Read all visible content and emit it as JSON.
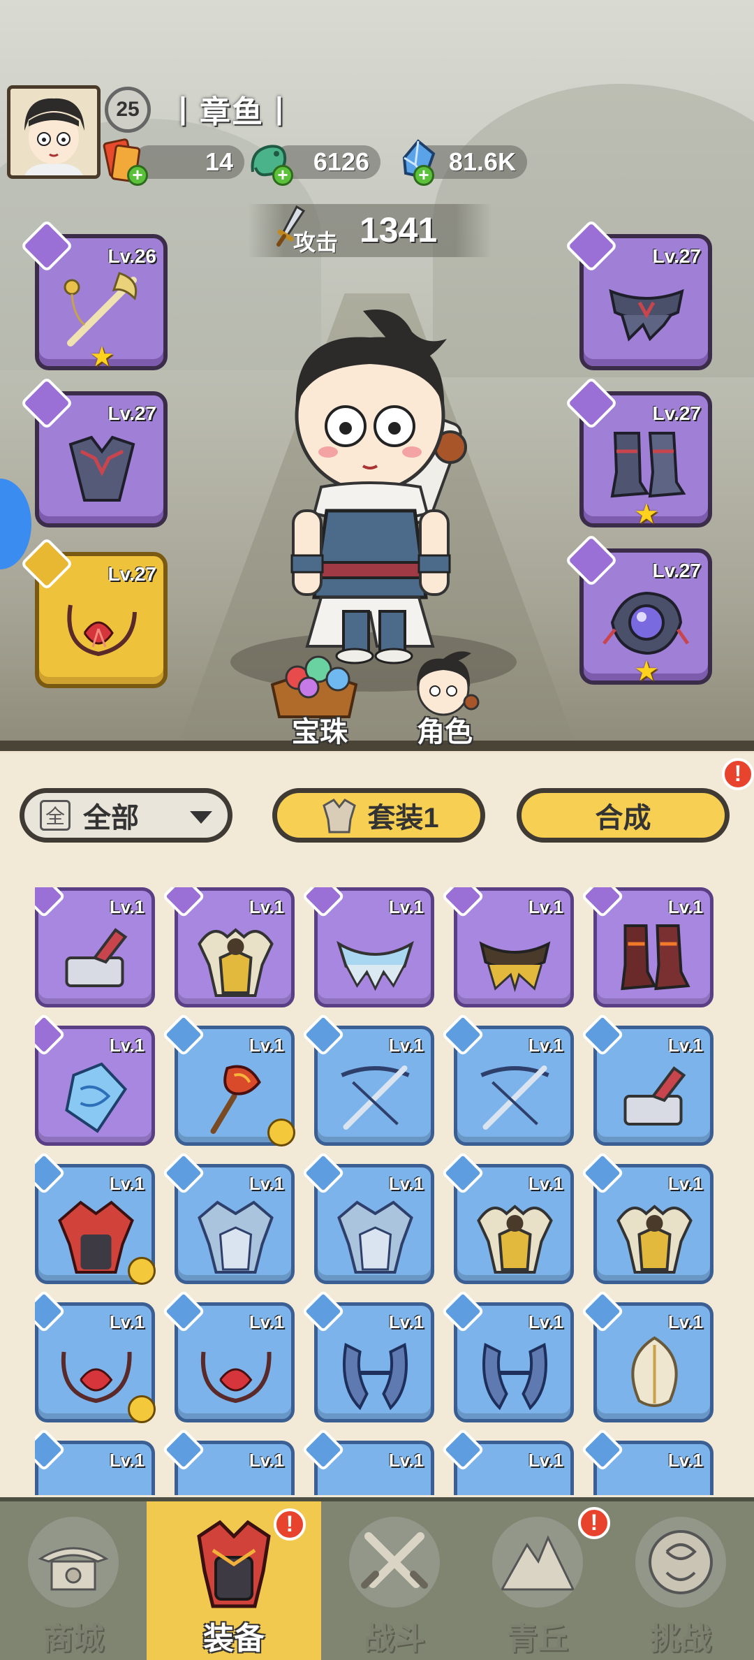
{
  "player": {
    "level": "25",
    "name": "丨章鱼丨"
  },
  "resources": [
    {
      "icon": "ticket-icon",
      "value": "14"
    },
    {
      "icon": "jade-dragon-icon",
      "value": "6126"
    },
    {
      "icon": "crystal-gem-icon",
      "value": "81.6K"
    }
  ],
  "attack": {
    "label": "攻击",
    "value": "1341"
  },
  "equipped": {
    "left": [
      {
        "slot": "weapon",
        "level": "Lv.26",
        "starred": true,
        "rarity": "purple"
      },
      {
        "slot": "armor",
        "level": "Lv.27",
        "starred": false,
        "rarity": "purple"
      },
      {
        "slot": "necklace",
        "level": "Lv.27",
        "starred": false,
        "rarity": "gold"
      }
    ],
    "right": [
      {
        "slot": "belt",
        "level": "Lv.27",
        "starred": false,
        "rarity": "purple"
      },
      {
        "slot": "boots",
        "level": "Lv.27",
        "starred": true,
        "rarity": "purple"
      },
      {
        "slot": "ring",
        "level": "Lv.27",
        "starred": true,
        "rarity": "purple"
      }
    ]
  },
  "scene_buttons": {
    "orbs": "宝珠",
    "role": "角色"
  },
  "toolbar": {
    "filter_icon_text": "全",
    "filter_label": "全部",
    "set_label": "套装1",
    "compose_label": "合成",
    "compose_alert": "!"
  },
  "inventory": [
    {
      "rarity": "purple",
      "type": "weapon",
      "level": "Lv.1",
      "art": "anvil-hammer-icon"
    },
    {
      "rarity": "purple",
      "type": "armor",
      "level": "Lv.1",
      "art": "gold-feather-armor-icon"
    },
    {
      "rarity": "purple",
      "type": "belt",
      "level": "Lv.1",
      "art": "ice-fur-belt-icon"
    },
    {
      "rarity": "purple",
      "type": "belt",
      "level": "Lv.1",
      "art": "gold-fur-belt-icon"
    },
    {
      "rarity": "purple",
      "type": "boots",
      "level": "Lv.1",
      "art": "fire-boots-icon"
    },
    {
      "rarity": "purple",
      "type": "ring",
      "level": "Lv.1",
      "art": "crystal-pendant-icon"
    },
    {
      "rarity": "blue",
      "type": "weapon",
      "level": "Lv.1",
      "art": "fire-slingshot-icon",
      "badge": true
    },
    {
      "rarity": "blue",
      "type": "weapon",
      "level": "Lv.1",
      "art": "crossbow-icon"
    },
    {
      "rarity": "blue",
      "type": "weapon",
      "level": "Lv.1",
      "art": "crossbow-icon"
    },
    {
      "rarity": "blue",
      "type": "weapon",
      "level": "Lv.1",
      "art": "anvil-hammer-icon"
    },
    {
      "rarity": "blue",
      "type": "armor",
      "level": "Lv.1",
      "art": "red-dragon-armor-icon",
      "badge": true
    },
    {
      "rarity": "blue",
      "type": "armor",
      "level": "Lv.1",
      "art": "ice-armor-icon"
    },
    {
      "rarity": "blue",
      "type": "armor",
      "level": "Lv.1",
      "art": "ice-armor-icon"
    },
    {
      "rarity": "blue",
      "type": "armor",
      "level": "Lv.1",
      "art": "gold-feather-armor-icon"
    },
    {
      "rarity": "blue",
      "type": "armor",
      "level": "Lv.1",
      "art": "gold-feather-armor-icon"
    },
    {
      "rarity": "blue",
      "type": "necklace",
      "level": "Lv.1",
      "art": "red-necklace-icon",
      "badge": true
    },
    {
      "rarity": "blue",
      "type": "necklace",
      "level": "Lv.1",
      "art": "red-necklace-icon"
    },
    {
      "rarity": "blue",
      "type": "necklace",
      "level": "Lv.1",
      "art": "ice-horn-icon"
    },
    {
      "rarity": "blue",
      "type": "necklace",
      "level": "Lv.1",
      "art": "ice-horn-icon"
    },
    {
      "rarity": "blue",
      "type": "necklace",
      "level": "Lv.1",
      "art": "feather-bundle-icon"
    },
    {
      "rarity": "blue",
      "type": "belt",
      "level": "Lv.1",
      "art": "belt-icon"
    },
    {
      "rarity": "blue",
      "type": "belt",
      "level": "Lv.1",
      "art": "belt-icon"
    },
    {
      "rarity": "blue",
      "type": "belt",
      "level": "Lv.1",
      "art": "belt-icon"
    },
    {
      "rarity": "blue",
      "type": "belt",
      "level": "Lv.1",
      "art": "belt-icon"
    },
    {
      "rarity": "blue",
      "type": "belt",
      "level": "Lv.1",
      "art": "belt-icon"
    }
  ],
  "nav": [
    {
      "label": "商城",
      "icon": "shop-pagoda-icon",
      "active": false,
      "alert": ""
    },
    {
      "label": "装备",
      "icon": "equipment-helmet-icon",
      "active": true,
      "alert": "!"
    },
    {
      "label": "战斗",
      "icon": "crossed-swords-icon",
      "active": false,
      "alert": ""
    },
    {
      "label": "青丘",
      "icon": "mountain-icon",
      "active": false,
      "alert": "!"
    },
    {
      "label": "挑战",
      "icon": "challenge-orb-icon",
      "active": false,
      "alert": ""
    }
  ],
  "colors": {
    "purple_card": "#a887e0",
    "blue_card": "#7cb3ea",
    "gold_card": "#efc23c",
    "button_yellow": "#f7cf53",
    "alert_red": "#e8432c",
    "nav_bg": "#7f8571"
  }
}
